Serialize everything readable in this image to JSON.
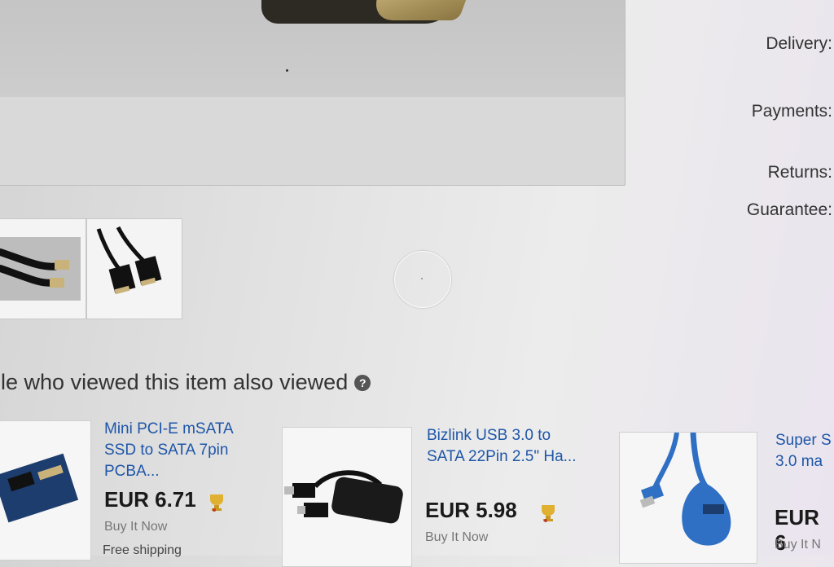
{
  "sidebar_labels": {
    "delivery": "Delivery:",
    "payments": "Payments:",
    "returns": "Returns:",
    "guarantee": "Guarantee:"
  },
  "related": {
    "heading": "ple who viewed this item also viewed",
    "help_icon": "help-icon",
    "items": [
      {
        "title_line1": "Mini PCI-E mSATA",
        "title_line2": "SSD to SATA 7pin",
        "title_line3": "PCBA...",
        "price": "EUR 6.71",
        "buy_format": "Buy It Now",
        "shipping": "Free shipping",
        "badge_icon": "top-rated-seller-icon"
      },
      {
        "title_line1": "Bizlink USB 3.0 to",
        "title_line2": "SATA 22Pin 2.5\" Ha...",
        "price": "EUR 5.98",
        "buy_format": "Buy It Now",
        "badge_icon": "top-rated-seller-icon"
      },
      {
        "title_line1": "Super S",
        "title_line2": "3.0 ma",
        "price": "EUR 6",
        "buy_format": "Buy It N"
      }
    ]
  },
  "colors": {
    "link": "#1e56a8",
    "price": "#1a1a1a",
    "muted": "#777777"
  }
}
